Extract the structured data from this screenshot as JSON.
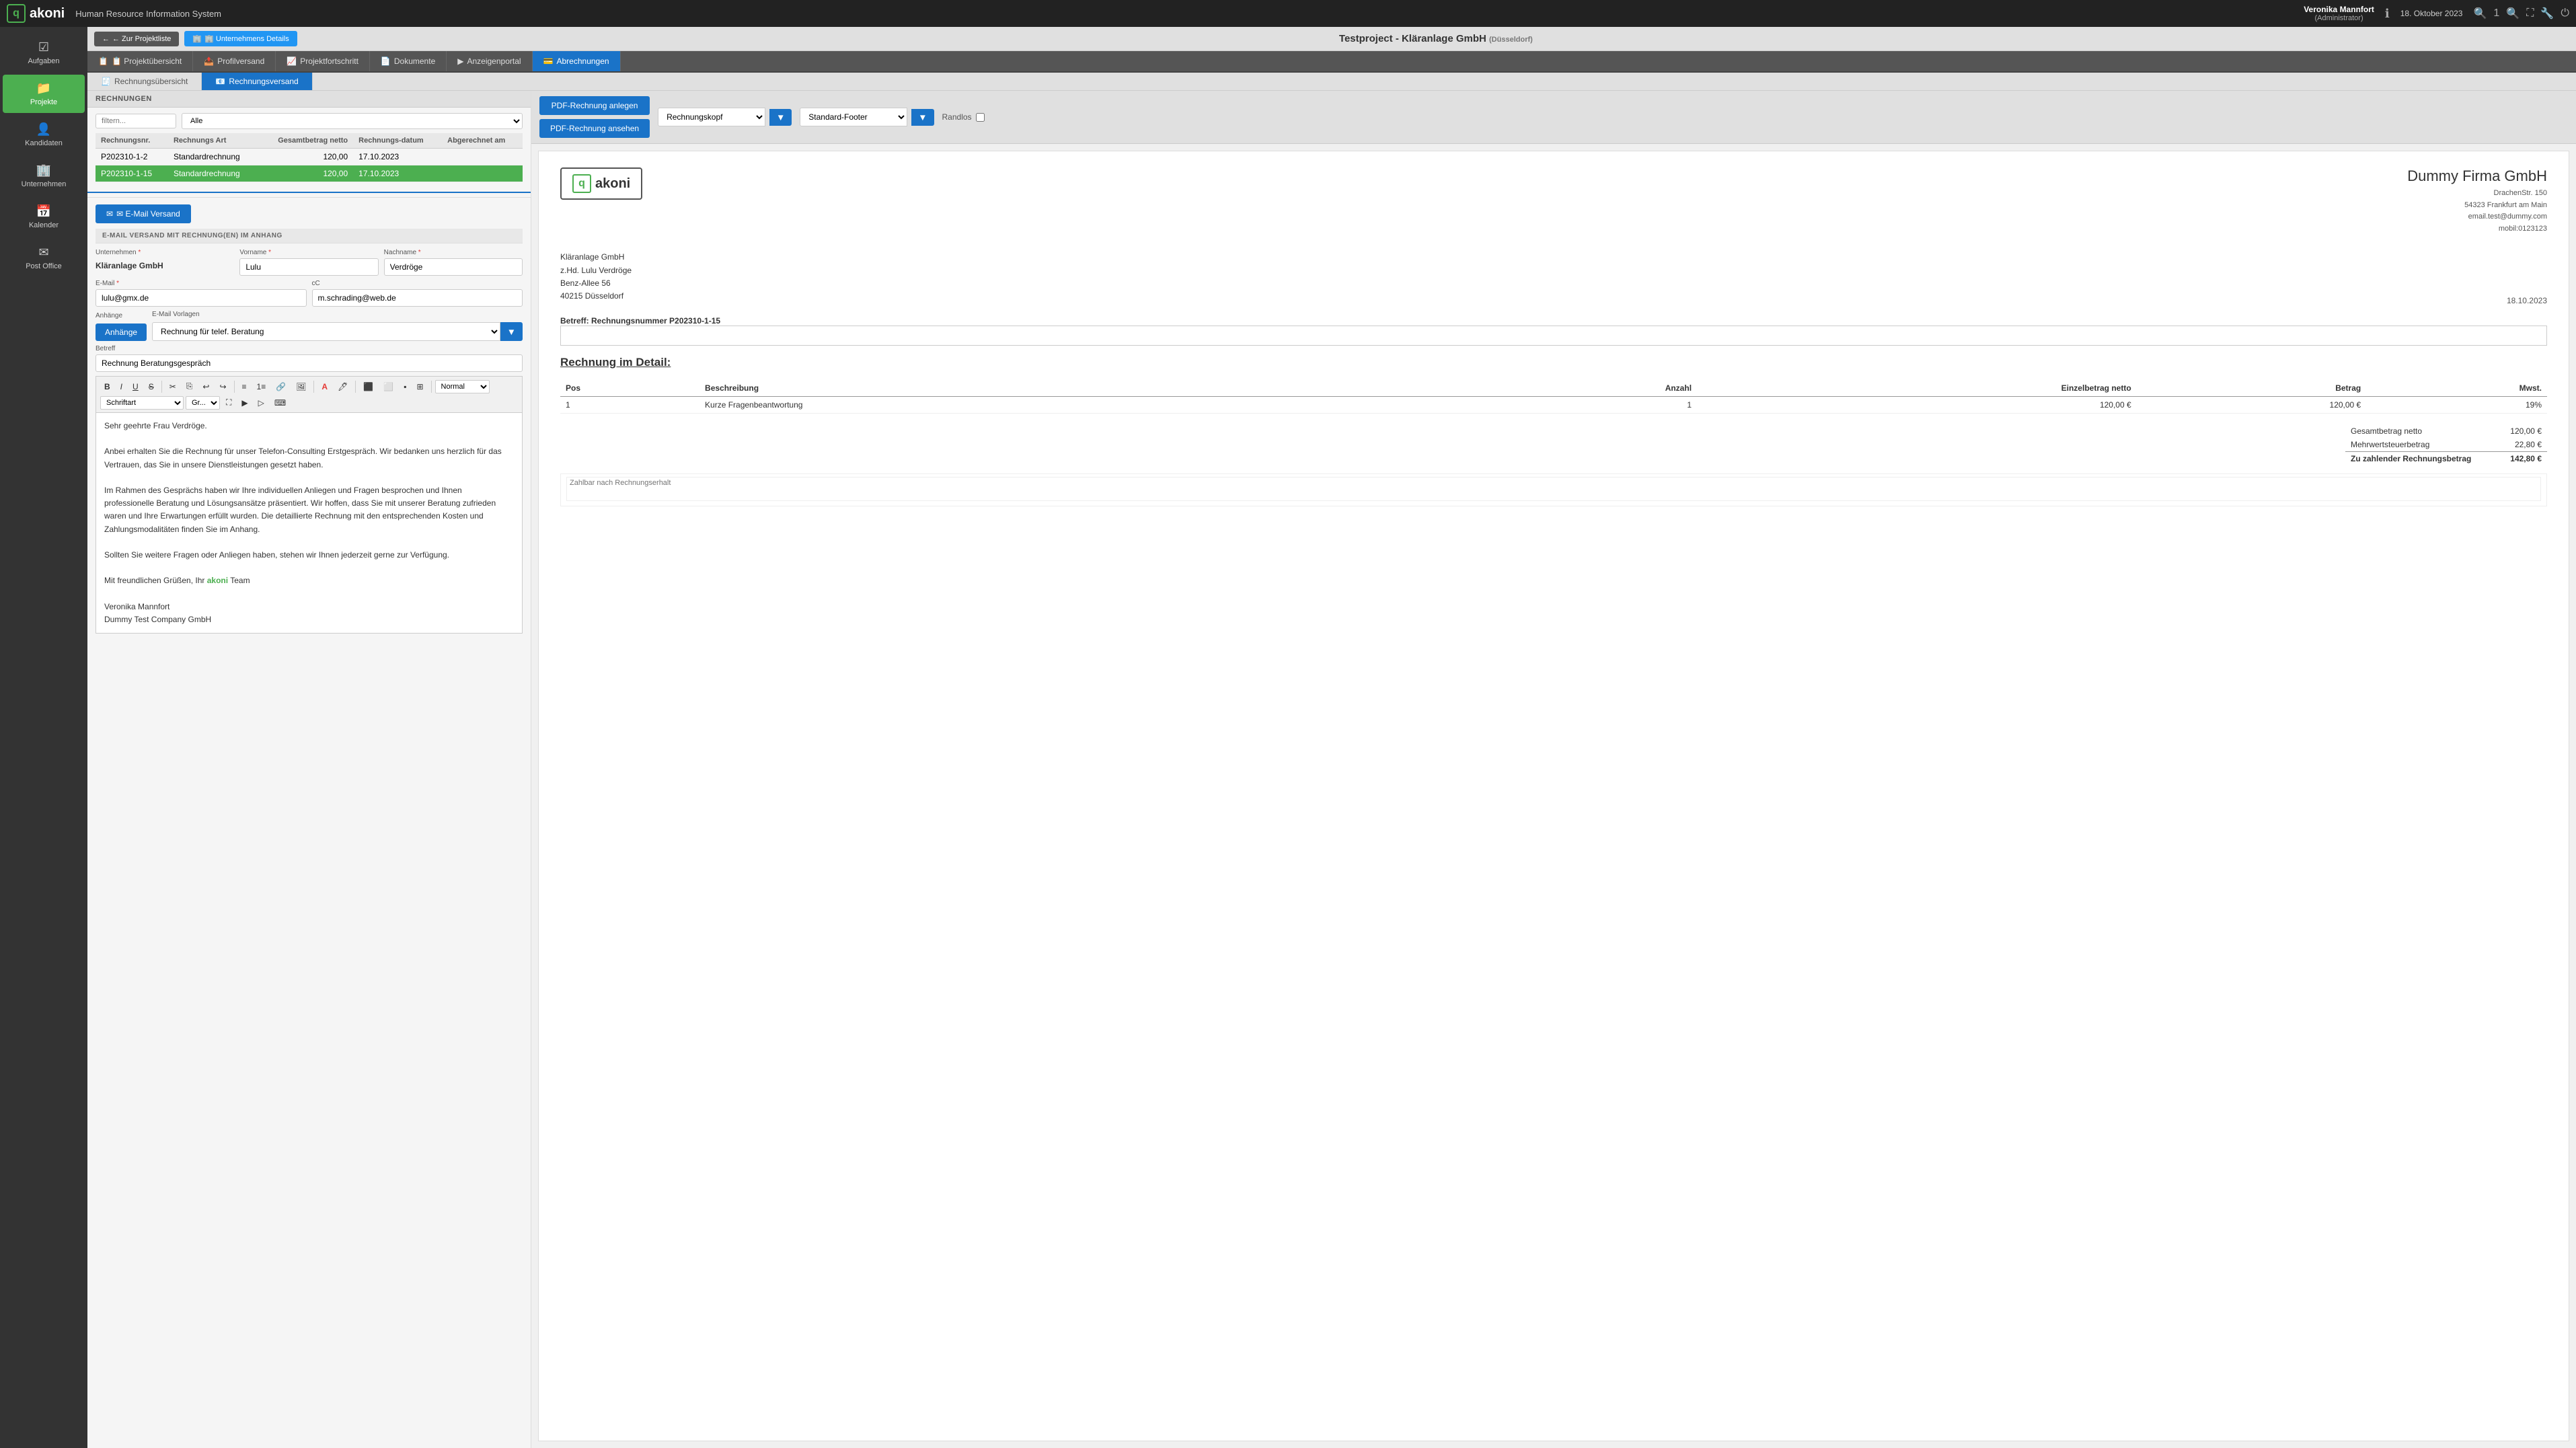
{
  "topbar": {
    "logo_text": "akoni",
    "system_title": "Human Resource Information System",
    "user_name": "Veronika Mannfort",
    "user_role": "(Administrator)",
    "info_icon": "ℹ",
    "date": "18. Oktober 2023",
    "zoom_icon": "🔍",
    "zoom_level": "1",
    "expand_icon": "⛶",
    "wrench_icon": "🔧",
    "power_icon": "⏻"
  },
  "sidebar": {
    "items": [
      {
        "label": "Aufgaben",
        "icon": "☑",
        "active": false
      },
      {
        "label": "Projekte",
        "icon": "📁",
        "active": true
      },
      {
        "label": "Kandidaten",
        "icon": "👤",
        "active": false
      },
      {
        "label": "Unternehmen",
        "icon": "🏢",
        "active": false
      },
      {
        "label": "Kalender",
        "icon": "📅",
        "active": false
      },
      {
        "label": "Post Office",
        "icon": "✉",
        "active": false
      }
    ]
  },
  "project_header": {
    "back_btn": "← Zur Projektliste",
    "company_btn": "🏢 Unternehmens Details",
    "title": "Testproject - Kläranlage GmbH",
    "location": "(Düsseldorf)"
  },
  "tabs": [
    {
      "label": "📋 Projektübersicht",
      "active": false
    },
    {
      "label": "📤 Profilversand",
      "active": false
    },
    {
      "label": "📈 Projektfortschritt",
      "active": false
    },
    {
      "label": "📄 Dokumente",
      "active": false
    },
    {
      "label": "▶ Anzeigenportal",
      "active": false
    },
    {
      "label": "💳 Abrechnungen",
      "active": true
    }
  ],
  "subtabs": [
    {
      "label": "🧾 Rechnungsübersicht",
      "active": false
    },
    {
      "label": "📧 Rechnungsversand",
      "active": true
    }
  ],
  "invoices": {
    "section_title": "RECHNUNGEN",
    "columns": [
      "Rechnungsnr.",
      "Rechnungs Art",
      "Gesamtbetrag netto",
      "Rechnungs-datum",
      "Abgerechnet am"
    ],
    "filter_placeholder": "filtern...",
    "filter_select_default": "Alle",
    "rows": [
      {
        "nr": "P202310-1-2",
        "art": "Standardrechnung",
        "betrag": "120,00",
        "datum": "17.10.2023",
        "abgerechnet": ""
      },
      {
        "nr": "P202310-1-15",
        "art": "Standardrechnung",
        "betrag": "120,00",
        "datum": "17.10.2023",
        "abgerechnet": "",
        "selected": true
      }
    ]
  },
  "email_section": {
    "send_btn": "✉ E-Mail Versand",
    "header": "E-MAIL VERSAND MIT RECHNUNG(EN) IM ANHANG",
    "unternehmen_label": "Unternehmen",
    "unternehmen_value": "Kläranlage GmbH",
    "vorname_label": "Vorname",
    "vorname_value": "Lulu",
    "nachname_label": "Nachname",
    "nachname_value": "Verdröge",
    "email_label": "E-Mail",
    "email_value": "lulu@gmx.de",
    "cc_label": "cC",
    "cc_value": "m.schrading@web.de",
    "anhaenge_label": "Anhänge",
    "anhaenge_btn": "Anhänge",
    "email_vorlage_label": "E-Mail Vorlagen",
    "email_vorlage_value": "Rechnung für telef. Beratung",
    "betreff_label": "Betreff",
    "betreff_value": "Rechnung Beratungsgespräch",
    "toolbar": {
      "bold": "B",
      "italic": "I",
      "underline": "U",
      "strikethrough": "S",
      "cut": "✂",
      "copy": "⎘",
      "undo": "↩",
      "redo": "↪",
      "list_ul": "≡",
      "list_ol": "1≡",
      "link": "🔗",
      "image": "🖼",
      "font_color": "A",
      "highlight": "🖊",
      "align_left": "⬛",
      "align_center": "⬜",
      "align_right": "▪",
      "table_icon": "⊞",
      "normal_label": "Normal",
      "font_label": "Schriftart",
      "size_label": "Gr..."
    },
    "body": {
      "line1": "Sehr geehrte Frau  Verdröge.",
      "line2": "Anbei erhalten Sie die Rechnung für unser Telefon-Consulting Erstgespräch. Wir bedanken uns herzlich für das Vertrauen, das Sie in unsere Dienstleistungen gesetzt haben.",
      "line3": "Im Rahmen des Gesprächs haben wir Ihre individuellen Anliegen und Fragen besprochen und Ihnen professionelle Beratung und Lösungsansätze präsentiert. Wir hoffen, dass Sie mit unserer Beratung zufrieden waren und Ihre Erwartungen erfüllt wurden. Die detaillierte Rechnung mit den entsprechenden Kosten und Zahlungsmodalitäten finden Sie im Anhang.",
      "line4": "Sollten Sie weitere Fragen oder Anliegen haben, stehen wir Ihnen jederzeit gerne zur Verfügung.",
      "line5_prefix": "Mit freundlichen Grüßen, Ihr",
      "line5_akoni": "akoni",
      "line5_suffix": "Team",
      "line6": "Veronika Mannfort",
      "line7": "Dummy Test Company GmbH"
    }
  },
  "right_panel": {
    "pdf_create_btn": "PDF-Rechnung anlegen",
    "pdf_view_btn": "PDF-Rechnung ansehen",
    "header_select": "Rechnungskopf",
    "footer_select": "Standard-Footer",
    "randlos_label": "Randlos"
  },
  "invoice_preview": {
    "logo_letter": "q",
    "logo_text": "akoni",
    "company_name": "Dummy Firma GmbH",
    "company_street": "DrachenStr. 150",
    "company_city": "54323 Frankfurt am Main",
    "company_email": "email.test@dummy.com",
    "company_mobile": "mobil:0123123",
    "recipient_name": "Kläranlage GmbH",
    "recipient_attn": "z.Hd. Lulu Verdröge",
    "recipient_street": "Benz-Allee 56",
    "recipient_city": "40215 Düsseldorf",
    "invoice_date": "18.10.2023",
    "subject_label": "Betreff: Rechnungsnummer P202310-1-15",
    "invoice_title": "Rechnung im Detail:",
    "table_cols": [
      "Pos",
      "Beschreibung",
      "Anzahl",
      "Einzelbetrag netto",
      "Betrag",
      "Mwst."
    ],
    "table_rows": [
      {
        "pos": "1",
        "beschreibung": "Kurze Fragenbeantwortung",
        "anzahl": "1",
        "einzelbetrag": "120,00 €",
        "betrag": "120,00 €",
        "mwst": "19%"
      }
    ],
    "total_net_label": "Gesamtbetrag netto",
    "total_net_value": "120,00 €",
    "tax_label": "Mehrwertsteuerbetrag",
    "tax_value": "22,80 €",
    "total_label": "Zu zahlender Rechnungsbetrag",
    "total_value": "142,80 €",
    "note_label": "Zahlbar nach Rechnungserhalt"
  }
}
